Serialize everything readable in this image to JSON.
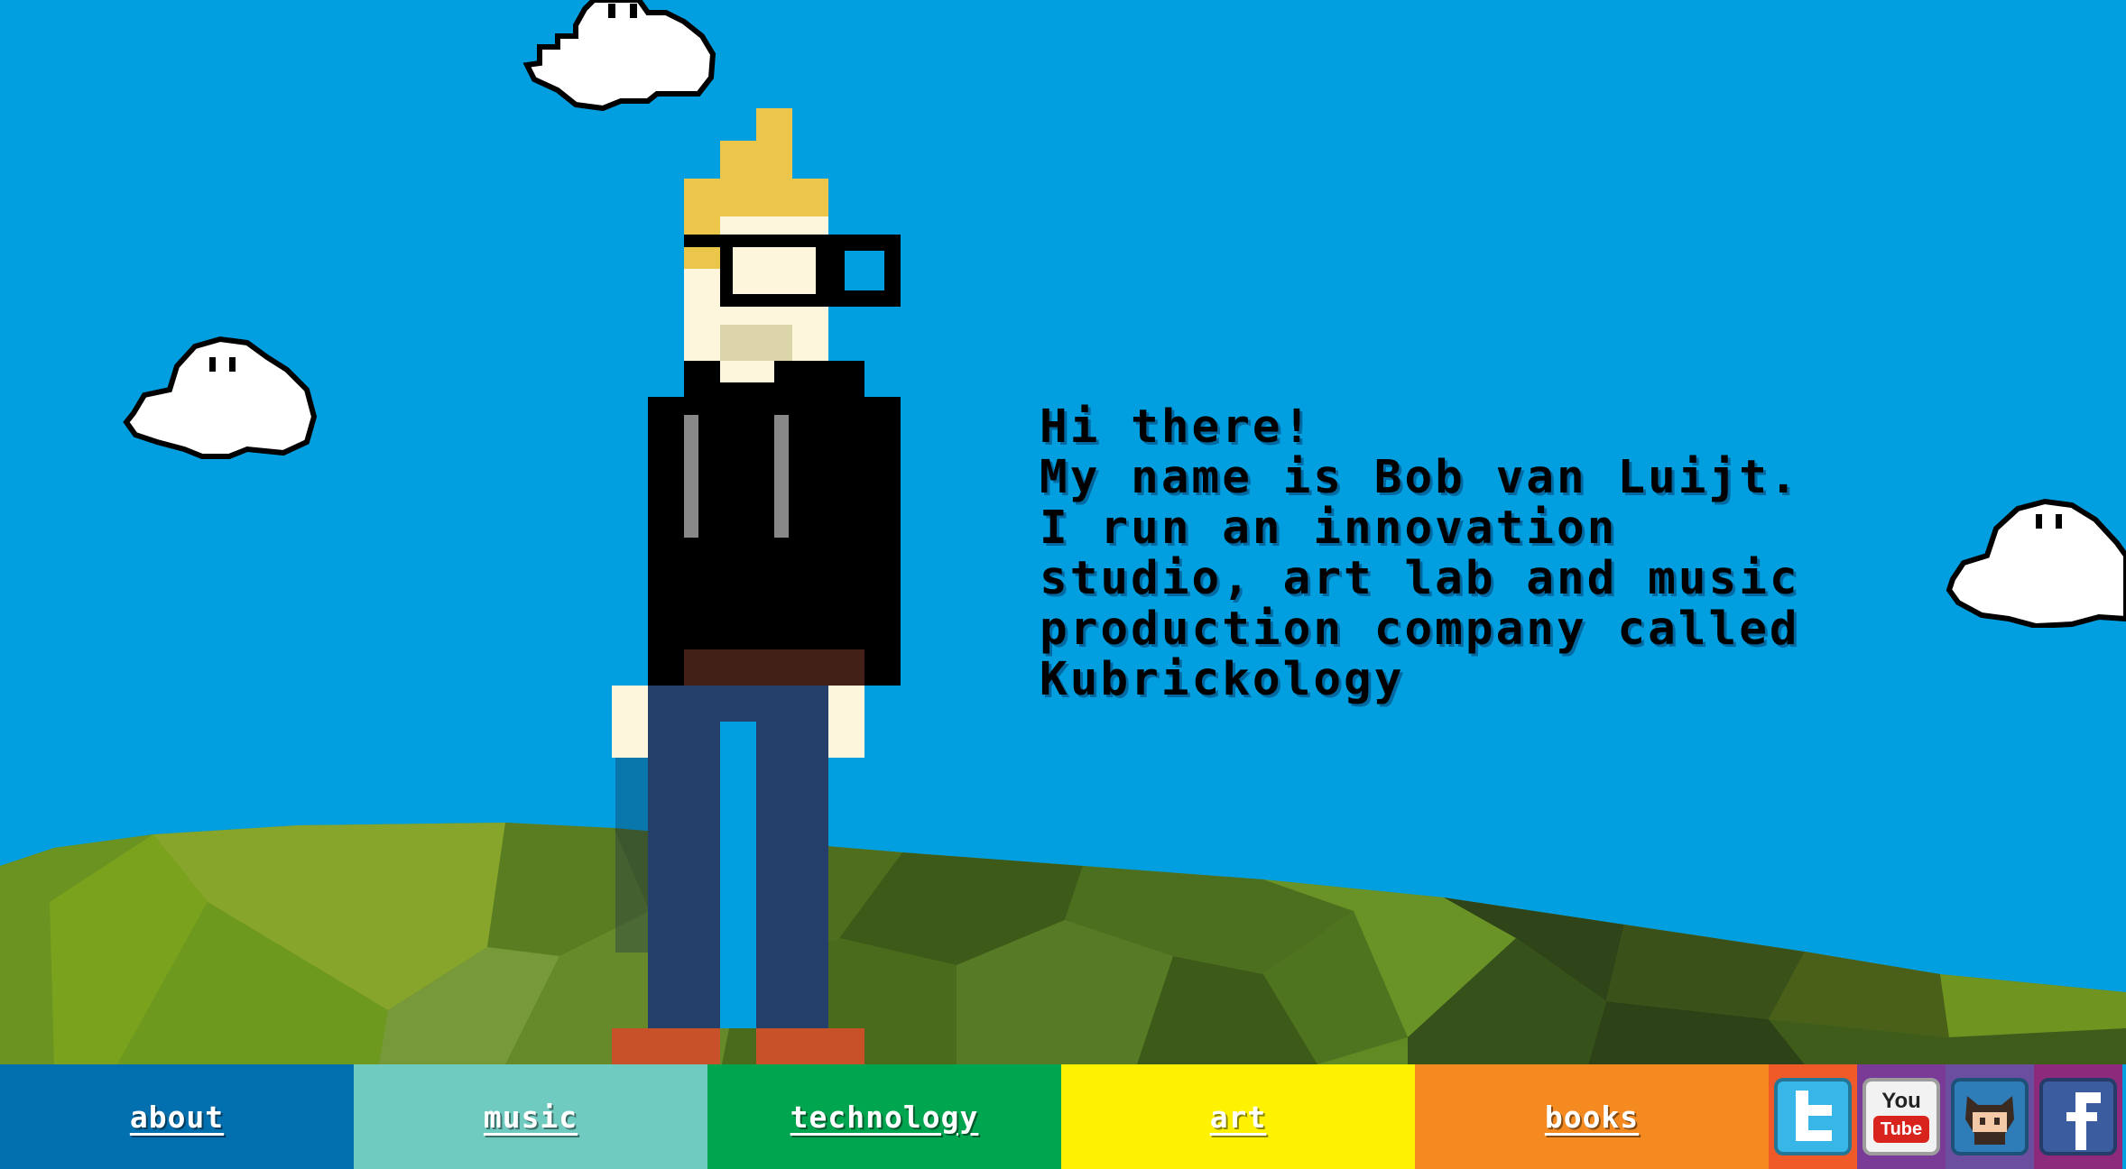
{
  "intro": {
    "lines": [
      "Hi there!",
      "My name is Bob van Luijt.",
      "I run an innovation",
      "studio, art lab and music",
      "production company called",
      "Kubrickology"
    ]
  },
  "nav": {
    "items": [
      {
        "label": "about",
        "color": "#0270ae"
      },
      {
        "label": "music",
        "color": "#6fcac0"
      },
      {
        "label": "technology",
        "color": "#00a54f"
      },
      {
        "label": "art",
        "color": "#fff200"
      },
      {
        "label": "books",
        "color": "#f58a20"
      }
    ]
  },
  "social": {
    "twitter": {
      "icon": "twitter-icon",
      "bg": "#f05a28"
    },
    "youtube": {
      "icon": "youtube-icon",
      "bg": "#7a3b97",
      "line1": "You",
      "line2": "Tube"
    },
    "github": {
      "icon": "github-octocat-icon",
      "bg": "#6b4ea0"
    },
    "facebook": {
      "icon": "facebook-icon",
      "bg": "#8e2a7c"
    }
  },
  "colors": {
    "sky": "#019fe0",
    "hair": "#ecc64a",
    "skin": "#fdf5dc",
    "hoodie": "#000000",
    "jeans": "#243f6a",
    "shoes": "#c8512a"
  }
}
